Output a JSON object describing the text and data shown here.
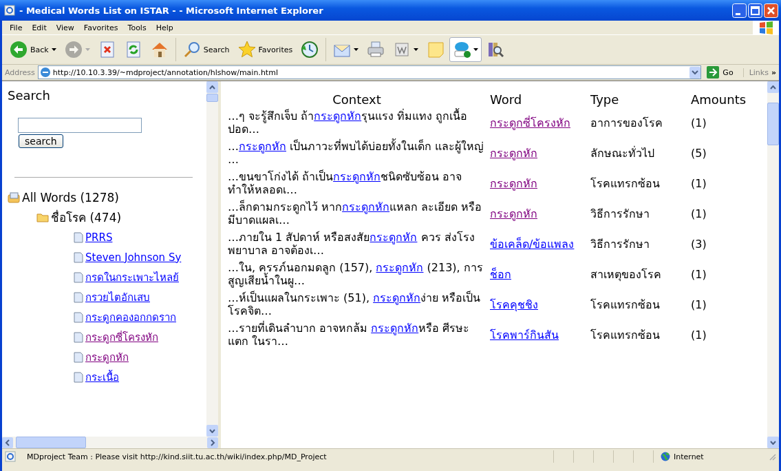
{
  "window": {
    "title": "- Medical Words List on ISTAR - - Microsoft Internet Explorer"
  },
  "menu": [
    "File",
    "Edit",
    "View",
    "Favorites",
    "Tools",
    "Help"
  ],
  "toolbar": [
    {
      "kind": "back",
      "label": "Back",
      "dropdown": true,
      "disabled": false
    },
    {
      "kind": "forward",
      "dropdown": true,
      "disabled": true
    },
    {
      "kind": "stop",
      "dropdown": false,
      "disabled": false
    },
    {
      "kind": "refresh",
      "dropdown": false,
      "disabled": false
    },
    {
      "kind": "home",
      "dropdown": false,
      "disabled": false
    },
    {
      "kind": "search",
      "label": "Search",
      "dropdown": false,
      "disabled": false
    },
    {
      "kind": "favorites",
      "label": "Favorites",
      "dropdown": false,
      "disabled": false
    },
    {
      "kind": "history",
      "dropdown": false,
      "disabled": false
    },
    {
      "kind": "mail",
      "dropdown": true,
      "disabled": false
    },
    {
      "kind": "print",
      "dropdown": false,
      "disabled": false
    },
    {
      "kind": "word",
      "dropdown": true,
      "disabled": false
    },
    {
      "kind": "note",
      "dropdown": false,
      "disabled": false
    },
    {
      "kind": "phone",
      "dropdown": true,
      "disabled": false
    },
    {
      "kind": "research",
      "dropdown": false,
      "disabled": false
    }
  ],
  "address": {
    "label": "Address",
    "url": "http://10.10.3.39/~mdproject/annotation/hlshow/main.html",
    "go": "Go",
    "links": "Links",
    "more": "»"
  },
  "sidebar": {
    "heading": "Search",
    "button": "search",
    "tree": {
      "label": "All Words (1278)",
      "children": [
        {
          "label": "ชื่อโรค (474)",
          "children": [
            {
              "label": "PRRS",
              "visited": false
            },
            {
              "label": "Steven Johnson Sy",
              "visited": false
            },
            {
              "label": "กรดในกระเพาะไหลย้",
              "visited": false
            },
            {
              "label": "กรวยไตอักเสบ",
              "visited": false
            },
            {
              "label": "กระดูกคองอกกดราก",
              "visited": false
            },
            {
              "label": "กระดูกซี่โครงหัก",
              "visited": true
            },
            {
              "label": "กระดูกหัก",
              "visited": true
            },
            {
              "label": "กระเนื้อ",
              "visited": false
            }
          ]
        }
      ]
    }
  },
  "table": {
    "columns": [
      "Context",
      "Word",
      "Type",
      "Amounts"
    ],
    "rows": [
      {
        "context": {
          "before": "…ๆ จะรู้สึกเจ็บ ถ้า",
          "link": "กระดูกหัก",
          "after": "รุนแรง ทิ่มแทง ถูกเนื้อปอด…"
        },
        "word": {
          "text": "กระดูกซี่โครงหัก",
          "visited": true
        },
        "type": "อาการของโรค",
        "amount": "(1)"
      },
      {
        "context": {
          "before": "…",
          "link": "กระดูกหัก",
          "after": " เป็นภาวะที่พบได้บ่อยทั้งในเด็ก และผู้ใหญ่ …"
        },
        "word": {
          "text": "กระดูกหัก",
          "visited": true
        },
        "type": "ลักษณะทั่วไป",
        "amount": "(5)"
      },
      {
        "context": {
          "before": "…ขนขาโก่งได้ ถ้าเป็น",
          "link": "กระดูกหัก",
          "after": "ชนิดซับซ้อน อาจทำให้หลอดเ…"
        },
        "word": {
          "text": "กระดูกหัก",
          "visited": true
        },
        "type": "โรคแทรกซ้อน",
        "amount": "(1)"
      },
      {
        "context": {
          "before": "…ล็กดามกระดูกไว้ หาก",
          "link": "กระดูกหัก",
          "after": "แหลก ละเอียด หรือมีบาดแผลเ…"
        },
        "word": {
          "text": "กระดูกหัก",
          "visited": true
        },
        "type": "วิธีการรักษา",
        "amount": "(1)"
      },
      {
        "context": {
          "before": "…ภายใน 1 สัปดาห์ หรือสงสัย",
          "link": "กระดูกหัก",
          "after": " ควร ส่งโรงพยาบาล อาจต้องเ…"
        },
        "word": {
          "text": "ข้อเคล็ด/ข้อแพลง",
          "visited": false
        },
        "type": "วิธีการรักษา",
        "amount": "(3)"
      },
      {
        "context": {
          "before": "…ใน, ครรภ์นอกมดลูก (157), ",
          "link": "กระดูกหัก",
          "after": " (213), การสูญเสียน้ำในผู…"
        },
        "word": {
          "text": "ช็อก",
          "visited": false
        },
        "type": "สาเหตุของโรค",
        "amount": "(1)"
      },
      {
        "context": {
          "before": "…ห์เป็นแผลในกระเพาะ (51), ",
          "link": "กระดูกหัก",
          "after": "ง่าย หรือเป็นโรคจิต…"
        },
        "word": {
          "text": "โรคคุชชิง",
          "visited": false
        },
        "type": "โรคแทรกซ้อน",
        "amount": "(1)"
      },
      {
        "context": {
          "before": "…รายที่เดินลำบาก อาจหกล้ม ",
          "link": "กระดูกหัก",
          "after": "หรือ ศีรษะแตก ในรา…"
        },
        "word": {
          "text": "โรคพาร์กินสัน",
          "visited": false
        },
        "type": "โรคแทรกซ้อน",
        "amount": "(1)"
      }
    ]
  },
  "status_bar": {
    "text": "MDproject Team : Please visit http://kind.siit.tu.ac.th/wiki/index.php/MD_Project",
    "zone": "Internet"
  }
}
